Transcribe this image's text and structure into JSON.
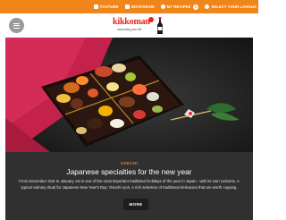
{
  "topbar": {
    "items": [
      {
        "label": "YOUTUBE",
        "icon": "youtube-icon"
      },
      {
        "label": "INSTAGRAM",
        "icon": "instagram-icon"
      },
      {
        "label": "MY RECIPES",
        "icon": "heart-icon",
        "badge": "0"
      },
      {
        "label": "SELECT YOUR LANGUA",
        "icon": "globe-icon"
      }
    ],
    "color": "#f08619"
  },
  "header": {
    "logo_text": "kikkoman",
    "logo_tagline": "seasoning your life",
    "menu_icon": "hamburger-icon"
  },
  "hero": {
    "image": "osechi-lacquer-box-photo"
  },
  "article": {
    "kicker": "OSECHI",
    "title": "Japanese specialties for the new year",
    "description": "From December 31st to January 1st is one of the most important traditional holidays of the year in Japan - with its own customs. A typical culinary ritual for Japanese New Year's Day: Osechi-ryori. A rich selection of traditional delicacies that are worth copying.",
    "more_label": "MORE"
  },
  "colors": {
    "accent": "#f08619",
    "brand_red": "#e1261c",
    "info_bg": "#303030"
  }
}
